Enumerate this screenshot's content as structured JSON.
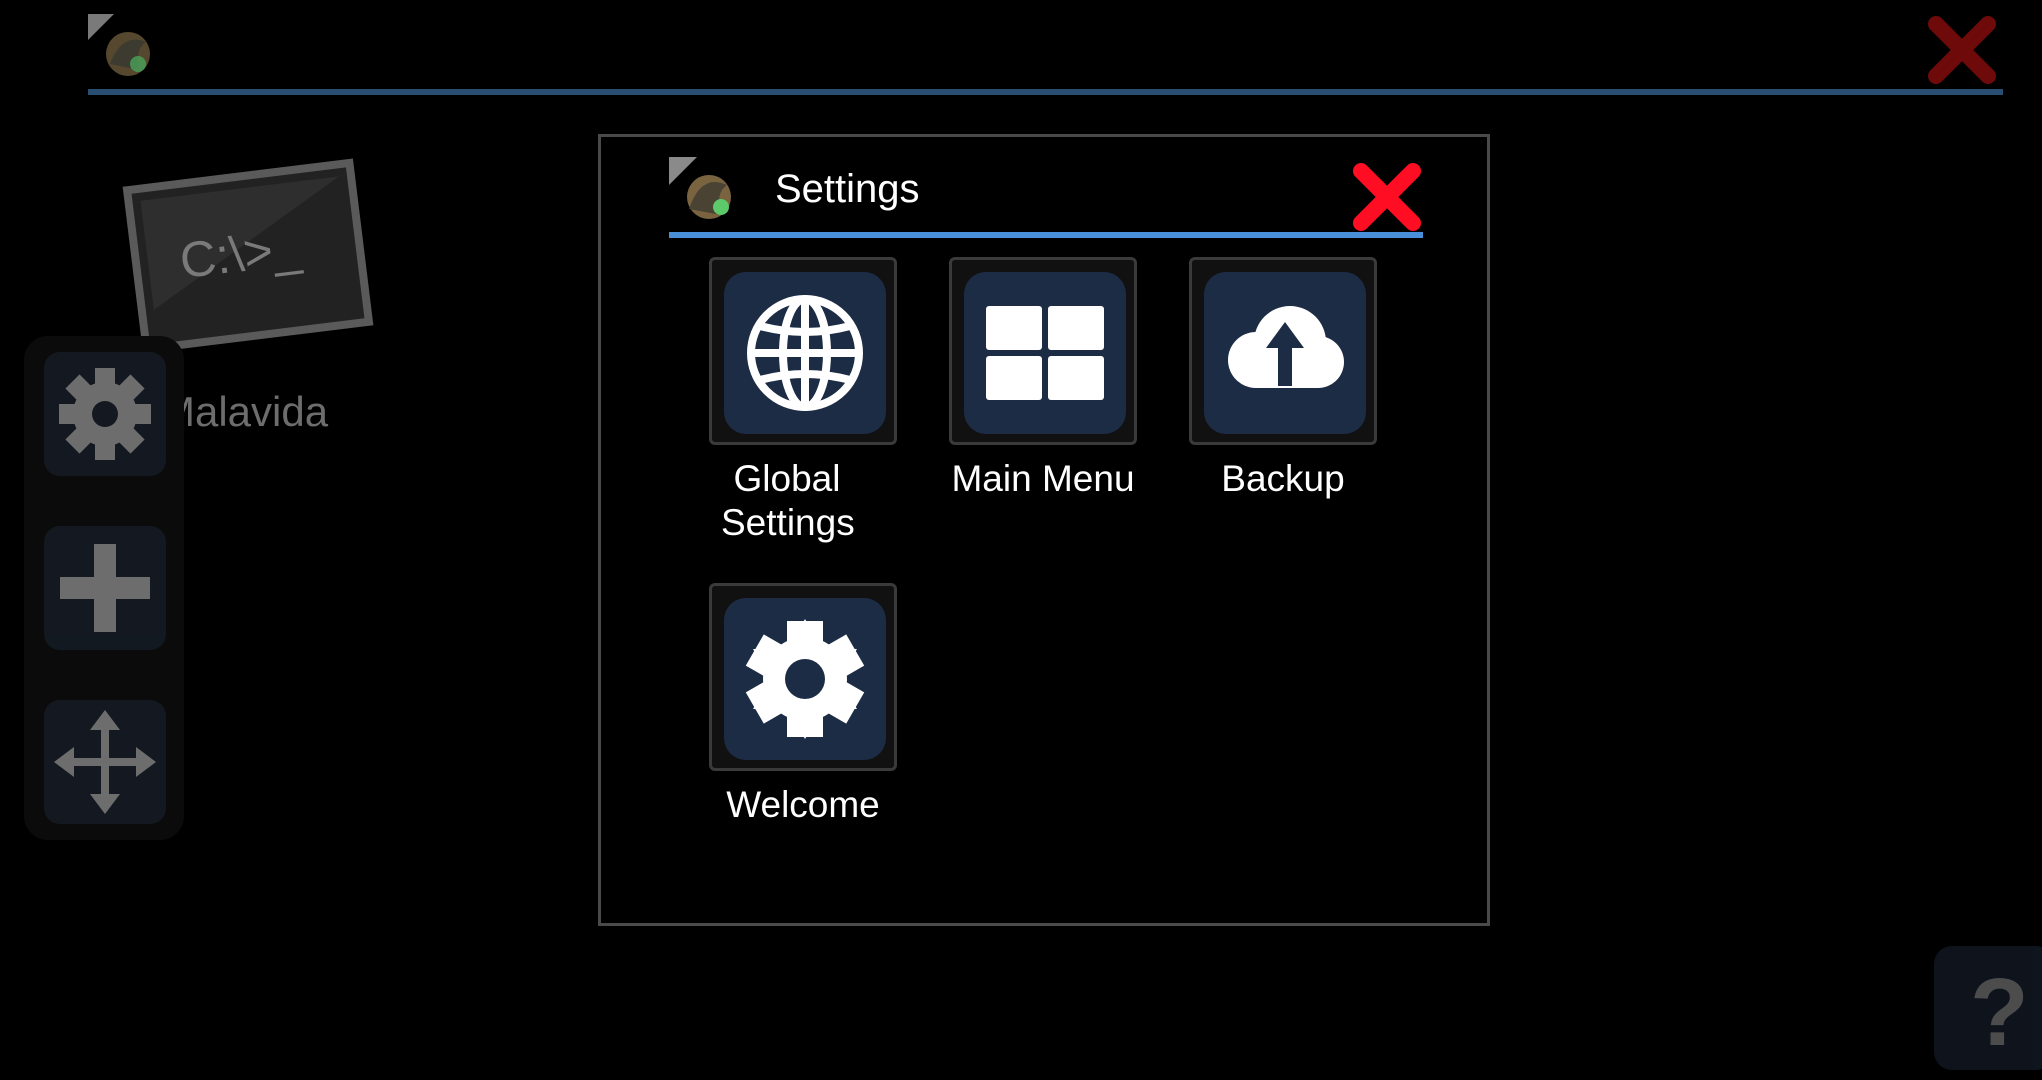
{
  "window": {
    "title_icon": "app-logo-icon",
    "close_icon": "close-icon",
    "accent_color": "#2a4d72"
  },
  "desktop": {
    "shortcut": {
      "icon": "terminal-icon",
      "icon_text": "C:\\>_",
      "label": "Malavida"
    }
  },
  "toolbar": {
    "items": [
      {
        "icon": "gear-icon"
      },
      {
        "icon": "plus-icon"
      },
      {
        "icon": "move-icon"
      }
    ]
  },
  "help": {
    "label": "?"
  },
  "dialog": {
    "title": "Settings",
    "logo_icon": "app-logo-icon",
    "close_icon": "close-icon",
    "accent_color": "#4a90d9",
    "tiles": [
      {
        "label": "Global Settings",
        "icon": "globe-icon"
      },
      {
        "label": "Main Menu",
        "icon": "grid-icon"
      },
      {
        "label": "Backup",
        "icon": "cloud-upload-icon"
      },
      {
        "label": "Welcome",
        "icon": "gear-icon"
      }
    ]
  }
}
